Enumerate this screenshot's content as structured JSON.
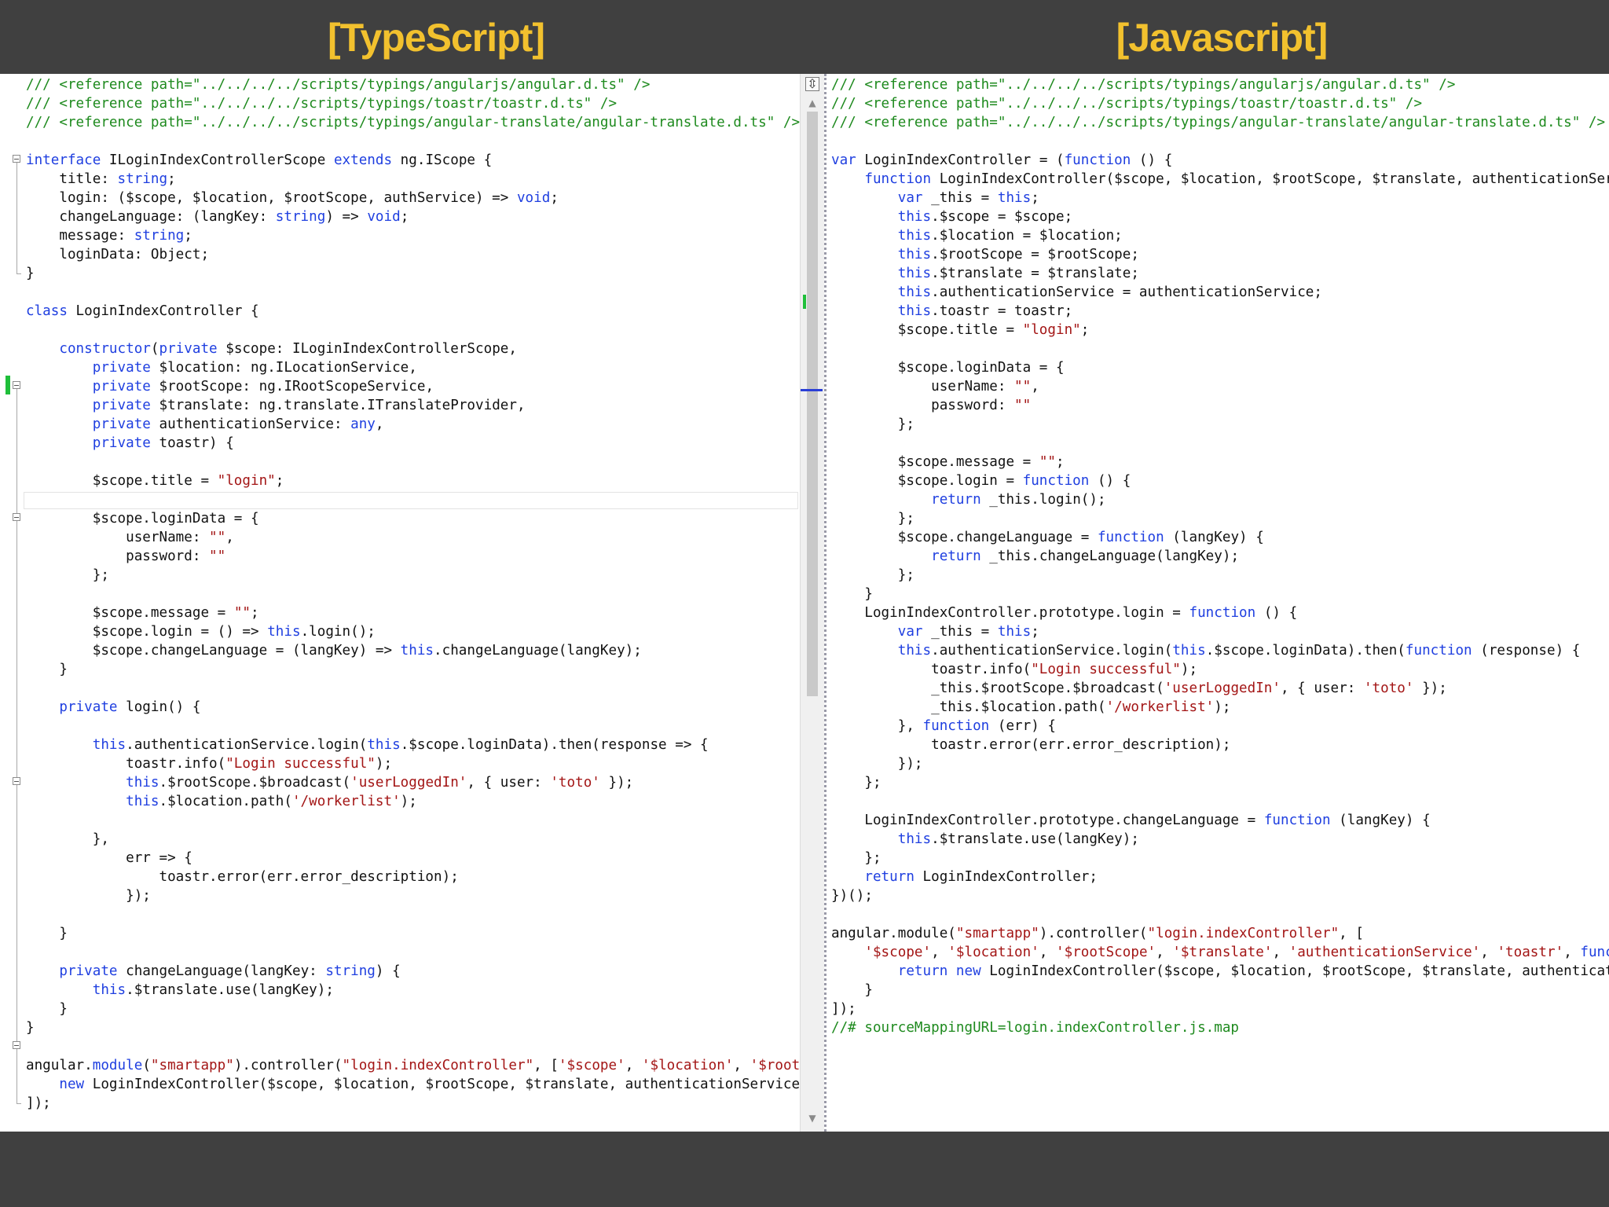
{
  "headers": {
    "left": "[TypeScript]",
    "right": "[Javascript]"
  },
  "colors": {
    "title": "#f2c12e",
    "background": "#404040",
    "comment": "#1e8a1e",
    "keyword": "#1f3fe0",
    "string": "#a31515"
  },
  "typescript": {
    "lines": [
      [
        [
          "cm",
          "/// <reference path=\"../../../../scripts/typings/angularjs/angular.d.ts\" />"
        ]
      ],
      [
        [
          "cm",
          "/// <reference path=\"../../../../scripts/typings/toastr/toastr.d.ts\" />"
        ]
      ],
      [
        [
          "cm",
          "/// <reference path=\"../../../../scripts/typings/angular-translate/angular-translate.d.ts\" />"
        ]
      ],
      [],
      [
        [
          "kw",
          "interface"
        ],
        [
          "",
          " ILoginIndexControllerScope "
        ],
        [
          "kw",
          "extends"
        ],
        [
          "",
          " ng.IScope {"
        ]
      ],
      [
        [
          "",
          "    title: "
        ],
        [
          "kw",
          "string"
        ],
        [
          "",
          ";"
        ]
      ],
      [
        [
          "",
          "    login: ($scope, $location, $rootScope, authService) => "
        ],
        [
          "kw",
          "void"
        ],
        [
          "",
          ";"
        ]
      ],
      [
        [
          "",
          "    changeLanguage: (langKey: "
        ],
        [
          "kw",
          "string"
        ],
        [
          "",
          ") => "
        ],
        [
          "kw",
          "void"
        ],
        [
          "",
          ";"
        ]
      ],
      [
        [
          "",
          "    message: "
        ],
        [
          "kw",
          "string"
        ],
        [
          "",
          ";"
        ]
      ],
      [
        [
          "",
          "    loginData: Object;"
        ]
      ],
      [
        [
          "",
          "}"
        ]
      ],
      [],
      [
        [
          "kw",
          "class"
        ],
        [
          "",
          " LoginIndexController {"
        ]
      ],
      [],
      [
        [
          "",
          "    "
        ],
        [
          "kw",
          "constructor"
        ],
        [
          "",
          "("
        ],
        [
          "kw",
          "private"
        ],
        [
          "",
          " $scope: ILoginIndexControllerScope,"
        ]
      ],
      [
        [
          "",
          "        "
        ],
        [
          "kw",
          "private"
        ],
        [
          "",
          " $location: ng.ILocationService,"
        ]
      ],
      [
        [
          "",
          "        "
        ],
        [
          "kw",
          "private"
        ],
        [
          "",
          " $rootScope: ng.IRootScopeService,"
        ]
      ],
      [
        [
          "",
          "        "
        ],
        [
          "kw",
          "private"
        ],
        [
          "",
          " $translate: ng.translate.ITranslateProvider,"
        ]
      ],
      [
        [
          "",
          "        "
        ],
        [
          "kw",
          "private"
        ],
        [
          "",
          " authenticationService: "
        ],
        [
          "kw",
          "any"
        ],
        [
          "",
          ","
        ]
      ],
      [
        [
          "",
          "        "
        ],
        [
          "kw",
          "private"
        ],
        [
          "",
          " toastr) {"
        ]
      ],
      [],
      [
        [
          "",
          "        $scope.title = "
        ],
        [
          "st",
          "\"login\""
        ],
        [
          "",
          ";"
        ]
      ],
      [],
      [
        [
          "",
          "        $scope.loginData = {"
        ]
      ],
      [
        [
          "",
          "            userName: "
        ],
        [
          "st",
          "\"\""
        ],
        [
          "",
          ","
        ]
      ],
      [
        [
          "",
          "            password: "
        ],
        [
          "st",
          "\"\""
        ]
      ],
      [
        [
          "",
          "        };"
        ]
      ],
      [],
      [
        [
          "",
          "        $scope.message = "
        ],
        [
          "st",
          "\"\""
        ],
        [
          "",
          ";"
        ]
      ],
      [
        [
          "",
          "        $scope.login = () => "
        ],
        [
          "kw",
          "this"
        ],
        [
          "",
          ".login();"
        ]
      ],
      [
        [
          "",
          "        $scope.changeLanguage = (langKey) => "
        ],
        [
          "kw",
          "this"
        ],
        [
          "",
          ".changeLanguage(langKey);"
        ]
      ],
      [
        [
          "",
          "    }"
        ]
      ],
      [],
      [
        [
          "",
          "    "
        ],
        [
          "kw",
          "private"
        ],
        [
          "",
          " login() {"
        ]
      ],
      [],
      [
        [
          "",
          "        "
        ],
        [
          "kw",
          "this"
        ],
        [
          "",
          ".authenticationService.login("
        ],
        [
          "kw",
          "this"
        ],
        [
          "",
          ".$scope.loginData).then(response => {"
        ]
      ],
      [
        [
          "",
          "            toastr.info("
        ],
        [
          "st",
          "\"Login successful\""
        ],
        [
          "",
          ");"
        ]
      ],
      [
        [
          "",
          "            "
        ],
        [
          "kw",
          "this"
        ],
        [
          "",
          ".$rootScope.$broadcast("
        ],
        [
          "st",
          "'userLoggedIn'"
        ],
        [
          "",
          ", { user: "
        ],
        [
          "st",
          "'toto'"
        ],
        [
          "",
          " });"
        ]
      ],
      [
        [
          "",
          "            "
        ],
        [
          "kw",
          "this"
        ],
        [
          "",
          ".$location.path("
        ],
        [
          "st",
          "'/workerlist'"
        ],
        [
          "",
          ");"
        ]
      ],
      [],
      [
        [
          "",
          "        },"
        ]
      ],
      [
        [
          "",
          "            err => {"
        ]
      ],
      [
        [
          "",
          "                toastr.error(err.error_description);"
        ]
      ],
      [
        [
          "",
          "            });"
        ]
      ],
      [],
      [
        [
          "",
          "    }"
        ]
      ],
      [],
      [
        [
          "",
          "    "
        ],
        [
          "kw",
          "private"
        ],
        [
          "",
          " changeLanguage(langKey: "
        ],
        [
          "kw",
          "string"
        ],
        [
          "",
          ") {"
        ]
      ],
      [
        [
          "",
          "        "
        ],
        [
          "kw",
          "this"
        ],
        [
          "",
          ".$translate.use(langKey);"
        ]
      ],
      [
        [
          "",
          "    }"
        ]
      ],
      [
        [
          "",
          "}"
        ]
      ],
      [],
      [
        [
          "",
          "angular."
        ],
        [
          "kw",
          "module"
        ],
        [
          "",
          "("
        ],
        [
          "st",
          "\"smartapp\""
        ],
        [
          "",
          ").controller("
        ],
        [
          "st",
          "\"login.indexController\""
        ],
        [
          "",
          ", ["
        ],
        [
          "st",
          "'$scope'"
        ],
        [
          "",
          ", "
        ],
        [
          "st",
          "'$location'"
        ],
        [
          "",
          ", "
        ],
        [
          "st",
          "'$rootS"
        ]
      ],
      [
        [
          "",
          "    "
        ],
        [
          "kw",
          "new"
        ],
        [
          "",
          " LoginIndexController($scope, $location, $rootScope, $translate, authenticationService,"
        ]
      ],
      [
        [
          "",
          "]);"
        ]
      ]
    ]
  },
  "javascript": {
    "lines": [
      [
        [
          "cm",
          "/// <reference path=\"../../../../scripts/typings/angularjs/angular.d.ts\" />"
        ]
      ],
      [
        [
          "cm",
          "/// <reference path=\"../../../../scripts/typings/toastr/toastr.d.ts\" />"
        ]
      ],
      [
        [
          "cm",
          "/// <reference path=\"../../../../scripts/typings/angular-translate/angular-translate.d.ts\" />"
        ]
      ],
      [],
      [
        [
          "kw",
          "var"
        ],
        [
          "",
          " LoginIndexController = ("
        ],
        [
          "kw",
          "function"
        ],
        [
          "",
          " () {"
        ]
      ],
      [
        [
          "",
          "    "
        ],
        [
          "kw",
          "function"
        ],
        [
          "",
          " LoginIndexController($scope, $location, $rootScope, $translate, authenticationServ"
        ]
      ],
      [
        [
          "",
          "        "
        ],
        [
          "kw",
          "var"
        ],
        [
          "",
          " _this = "
        ],
        [
          "kw",
          "this"
        ],
        [
          "",
          ";"
        ]
      ],
      [
        [
          "",
          "        "
        ],
        [
          "kw",
          "this"
        ],
        [
          "",
          ".$scope = $scope;"
        ]
      ],
      [
        [
          "",
          "        "
        ],
        [
          "kw",
          "this"
        ],
        [
          "",
          ".$location = $location;"
        ]
      ],
      [
        [
          "",
          "        "
        ],
        [
          "kw",
          "this"
        ],
        [
          "",
          ".$rootScope = $rootScope;"
        ]
      ],
      [
        [
          "",
          "        "
        ],
        [
          "kw",
          "this"
        ],
        [
          "",
          ".$translate = $translate;"
        ]
      ],
      [
        [
          "",
          "        "
        ],
        [
          "kw",
          "this"
        ],
        [
          "",
          ".authenticationService = authenticationService;"
        ]
      ],
      [
        [
          "",
          "        "
        ],
        [
          "kw",
          "this"
        ],
        [
          "",
          ".toastr = toastr;"
        ]
      ],
      [
        [
          "",
          "        $scope.title = "
        ],
        [
          "st",
          "\"login\""
        ],
        [
          "",
          ";"
        ]
      ],
      [],
      [
        [
          "",
          "        $scope.loginData = {"
        ]
      ],
      [
        [
          "",
          "            userName: "
        ],
        [
          "st",
          "\"\""
        ],
        [
          "",
          ","
        ]
      ],
      [
        [
          "",
          "            password: "
        ],
        [
          "st",
          "\"\""
        ]
      ],
      [
        [
          "",
          "        };"
        ]
      ],
      [],
      [
        [
          "",
          "        $scope.message = "
        ],
        [
          "st",
          "\"\""
        ],
        [
          "",
          ";"
        ]
      ],
      [
        [
          "",
          "        $scope.login = "
        ],
        [
          "kw",
          "function"
        ],
        [
          "",
          " () {"
        ]
      ],
      [
        [
          "",
          "            "
        ],
        [
          "kw",
          "return"
        ],
        [
          "",
          " _this.login();"
        ]
      ],
      [
        [
          "",
          "        };"
        ]
      ],
      [
        [
          "",
          "        $scope.changeLanguage = "
        ],
        [
          "kw",
          "function"
        ],
        [
          "",
          " (langKey) {"
        ]
      ],
      [
        [
          "",
          "            "
        ],
        [
          "kw",
          "return"
        ],
        [
          "",
          " _this.changeLanguage(langKey);"
        ]
      ],
      [
        [
          "",
          "        };"
        ]
      ],
      [
        [
          "",
          "    }"
        ]
      ],
      [
        [
          "",
          "    LoginIndexController.prototype.login = "
        ],
        [
          "kw",
          "function"
        ],
        [
          "",
          " () {"
        ]
      ],
      [
        [
          "",
          "        "
        ],
        [
          "kw",
          "var"
        ],
        [
          "",
          " _this = "
        ],
        [
          "kw",
          "this"
        ],
        [
          "",
          ";"
        ]
      ],
      [
        [
          "",
          "        "
        ],
        [
          "kw",
          "this"
        ],
        [
          "",
          ".authenticationService.login("
        ],
        [
          "kw",
          "this"
        ],
        [
          "",
          ".$scope.loginData).then("
        ],
        [
          "kw",
          "function"
        ],
        [
          "",
          " (response) {"
        ]
      ],
      [
        [
          "",
          "            toastr.info("
        ],
        [
          "st",
          "\"Login successful\""
        ],
        [
          "",
          ");"
        ]
      ],
      [
        [
          "",
          "            _this.$rootScope.$broadcast("
        ],
        [
          "st",
          "'userLoggedIn'"
        ],
        [
          "",
          ", { user: "
        ],
        [
          "st",
          "'toto'"
        ],
        [
          "",
          " });"
        ]
      ],
      [
        [
          "",
          "            _this.$location.path("
        ],
        [
          "st",
          "'/workerlist'"
        ],
        [
          "",
          ");"
        ]
      ],
      [
        [
          "",
          "        }, "
        ],
        [
          "kw",
          "function"
        ],
        [
          "",
          " (err) {"
        ]
      ],
      [
        [
          "",
          "            toastr.error(err.error_description);"
        ]
      ],
      [
        [
          "",
          "        });"
        ]
      ],
      [
        [
          "",
          "    };"
        ]
      ],
      [],
      [
        [
          "",
          "    LoginIndexController.prototype.changeLanguage = "
        ],
        [
          "kw",
          "function"
        ],
        [
          "",
          " (langKey) {"
        ]
      ],
      [
        [
          "",
          "        "
        ],
        [
          "kw",
          "this"
        ],
        [
          "",
          ".$translate.use(langKey);"
        ]
      ],
      [
        [
          "",
          "    };"
        ]
      ],
      [
        [
          "",
          "    "
        ],
        [
          "kw",
          "return"
        ],
        [
          "",
          " LoginIndexController;"
        ]
      ],
      [
        [
          "",
          "})();"
        ]
      ],
      [],
      [
        [
          "",
          "angular.module("
        ],
        [
          "st",
          "\"smartapp\""
        ],
        [
          "",
          ").controller("
        ],
        [
          "st",
          "\"login.indexController\""
        ],
        [
          "",
          ", ["
        ]
      ],
      [
        [
          "",
          "    "
        ],
        [
          "st",
          "'$scope'"
        ],
        [
          "",
          ", "
        ],
        [
          "st",
          "'$location'"
        ],
        [
          "",
          ", "
        ],
        [
          "st",
          "'$rootScope'"
        ],
        [
          "",
          ", "
        ],
        [
          "st",
          "'$translate'"
        ],
        [
          "",
          ", "
        ],
        [
          "st",
          "'authenticationService'"
        ],
        [
          "",
          ", "
        ],
        [
          "st",
          "'toastr'"
        ],
        [
          "",
          ", "
        ],
        [
          "kw",
          "func"
        ]
      ],
      [
        [
          "",
          "        "
        ],
        [
          "kw",
          "return"
        ],
        [
          "",
          " "
        ],
        [
          "kw",
          "new"
        ],
        [
          "",
          " LoginIndexController($scope, $location, $rootScope, $translate, authenticati"
        ]
      ],
      [
        [
          "",
          "    }"
        ]
      ],
      [
        [
          "",
          "]);"
        ]
      ],
      [
        [
          "cm",
          "//# sourceMappingURL=login.indexController.js.map"
        ]
      ]
    ]
  },
  "scrollbar": {
    "split_icon": "split-icon",
    "up_arrow": "▲",
    "down_arrow": "▼"
  }
}
